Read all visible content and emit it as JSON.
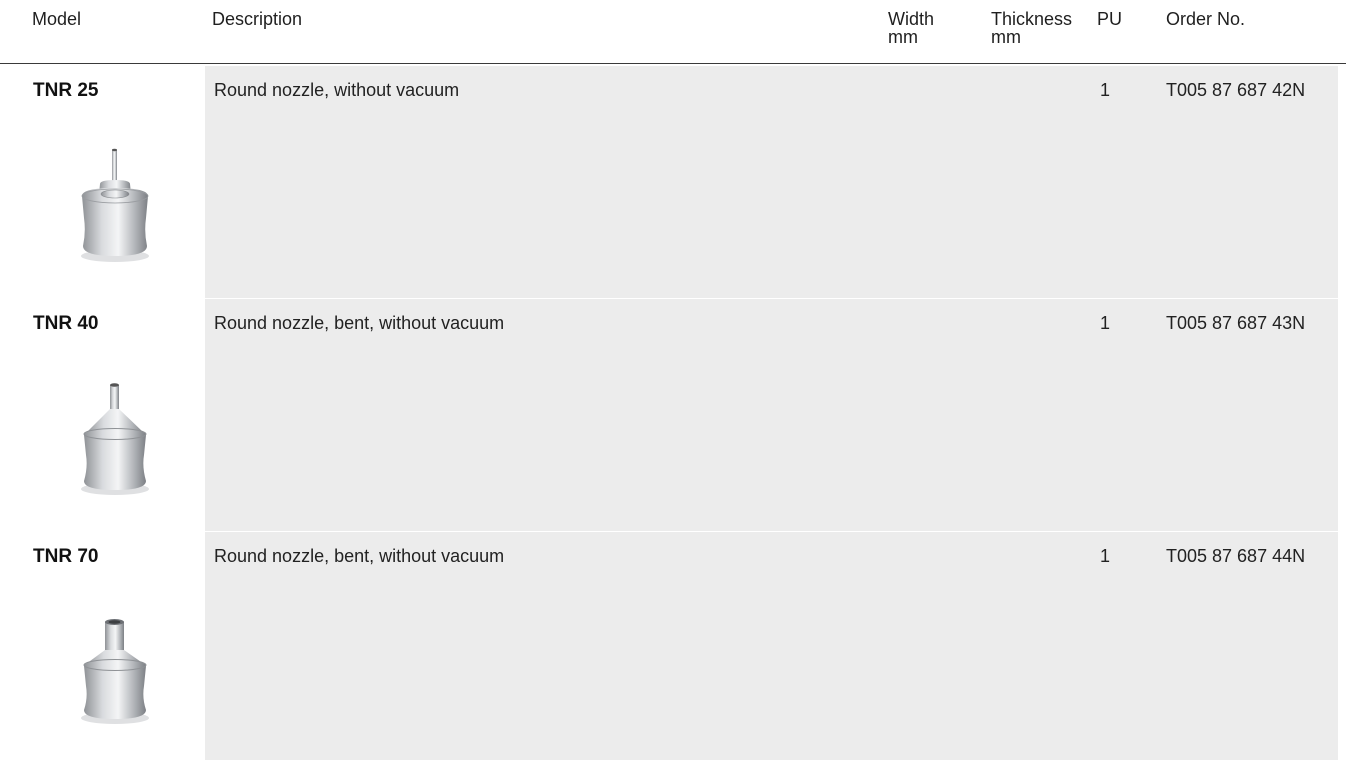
{
  "header": {
    "model": "Model",
    "description": "Description",
    "width": "Width",
    "width_unit": "mm",
    "thickness": "Thickness",
    "thickness_unit": "mm",
    "pu": "PU",
    "order_no": "Order No."
  },
  "rows": [
    {
      "model": "TNR 25",
      "description": "Round nozzle, without vacuum",
      "pu": "1",
      "order_no": "T005 87 687 42N",
      "image": "round-nozzle-thin-tip-icon"
    },
    {
      "model": "TNR 40",
      "description": "Round nozzle, bent, without vacuum",
      "pu": "1",
      "order_no": "T005 87 687 43N",
      "image": "round-nozzle-conical-tip-icon"
    },
    {
      "model": "TNR 70",
      "description": "Round nozzle, bent, without vacuum",
      "pu": "1",
      "order_no": "T005 87 687 44N",
      "image": "round-nozzle-wide-tip-icon"
    }
  ]
}
